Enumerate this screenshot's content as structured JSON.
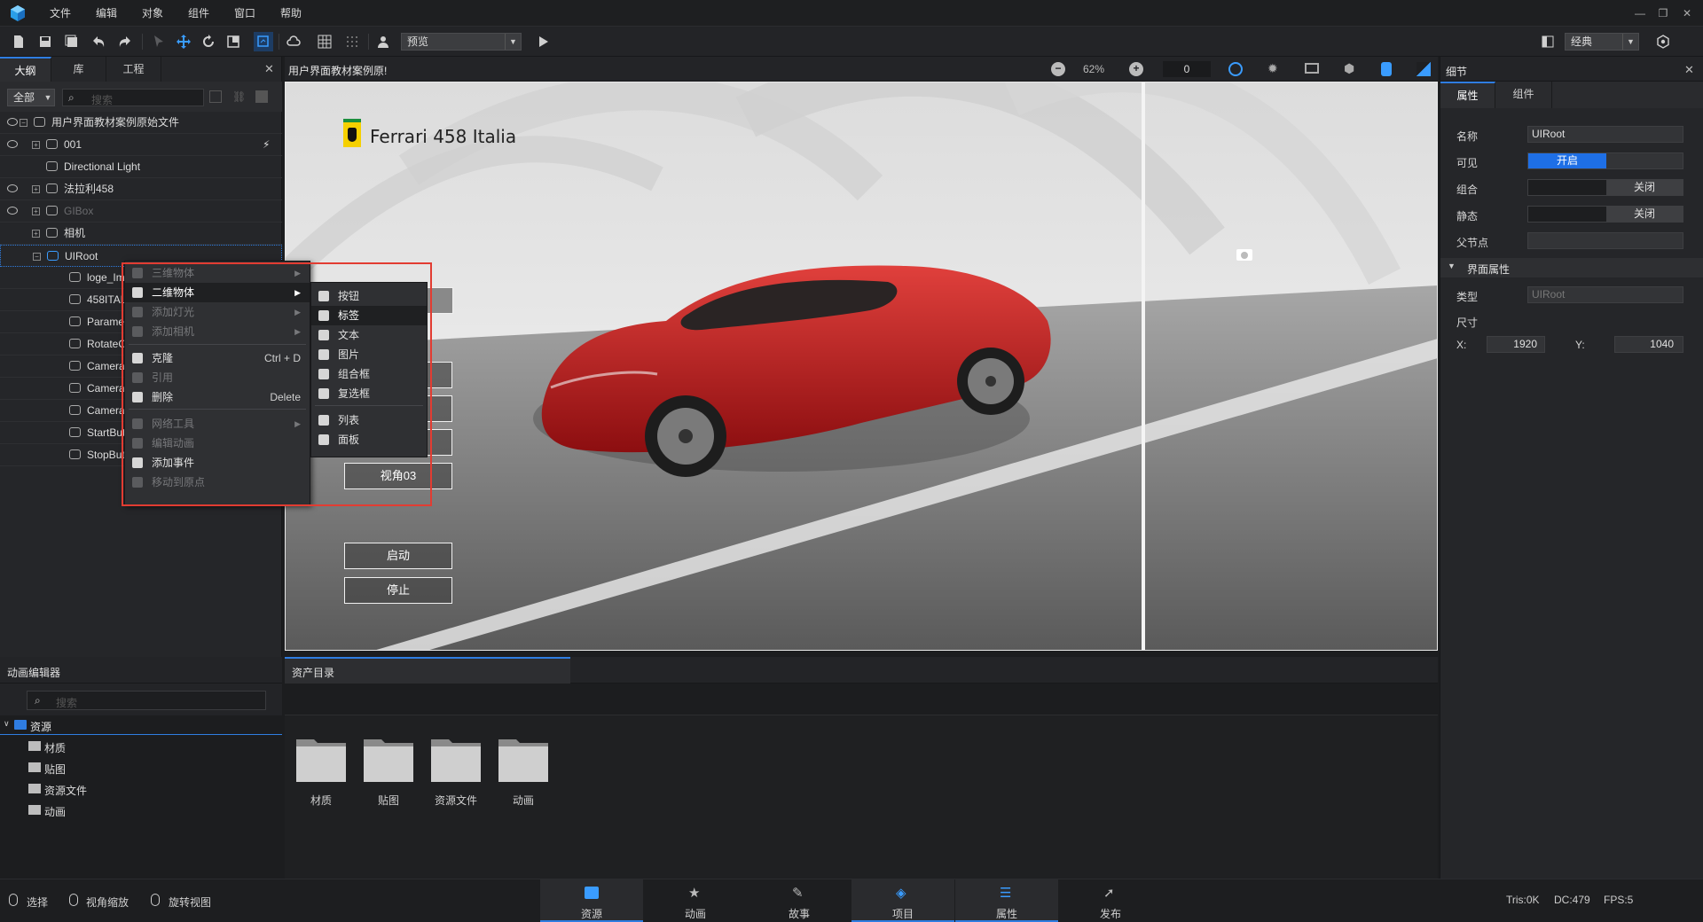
{
  "menubar": {
    "items": [
      "文件",
      "编辑",
      "对象",
      "组件",
      "窗口",
      "帮助"
    ]
  },
  "toolbar": {
    "preview_mode": "预览",
    "layout_mode": "经典"
  },
  "left_panel": {
    "tabs": [
      "大纲",
      "库",
      "工程"
    ],
    "filter": "全部",
    "search_placeholder": "搜索",
    "tree": [
      {
        "label": "用户界面教材案例原始文件",
        "level": 0
      },
      {
        "label": "001",
        "level": 1
      },
      {
        "label": "Directional Light",
        "level": 1
      },
      {
        "label": "法拉利458",
        "level": 1
      },
      {
        "label": "GIBox",
        "level": 1
      },
      {
        "label": "相机",
        "level": 1
      },
      {
        "label": "UIRoot",
        "level": 1
      },
      {
        "label": "loge_Ima",
        "level": 2
      },
      {
        "label": "458ITAL",
        "level": 2
      },
      {
        "label": "Paramet",
        "level": 2
      },
      {
        "label": "RotateCa",
        "level": 2
      },
      {
        "label": "Camera_",
        "level": 2
      },
      {
        "label": "Camera_",
        "level": 2
      },
      {
        "label": "Camera_",
        "level": 2
      },
      {
        "label": "StartButt",
        "level": 2
      },
      {
        "label": "StopButt",
        "level": 2
      }
    ]
  },
  "viewport": {
    "title": "用户界面教材案例原!",
    "zoom": "62%",
    "zoom_value": "0",
    "scene_title": "Ferrari 458 Italia",
    "buttons": {
      "view03": "视角03",
      "start": "启动",
      "stop": "停止"
    }
  },
  "context_menu": {
    "items": [
      {
        "label": "三维物体",
        "disabled": true,
        "submenu": true
      },
      {
        "label": "二维物体",
        "disabled": false,
        "submenu": true,
        "highlight": true
      },
      {
        "label": "添加灯光",
        "disabled": true,
        "submenu": true
      },
      {
        "label": "添加相机",
        "disabled": true,
        "submenu": true
      },
      {
        "label": "克隆",
        "disabled": false,
        "shortcut": "Ctrl + D"
      },
      {
        "label": "引用",
        "disabled": true
      },
      {
        "label": "删除",
        "disabled": false,
        "shortcut": "Delete"
      },
      {
        "label": "网络工具",
        "disabled": true,
        "submenu": true
      },
      {
        "label": "编辑动画",
        "disabled": true
      },
      {
        "label": "添加事件",
        "disabled": false
      },
      {
        "label": "移动到原点",
        "disabled": true
      }
    ],
    "submenu": [
      "按钮",
      "标签",
      "文本",
      "图片",
      "组合框",
      "复选框",
      "列表",
      "面板"
    ],
    "submenu_highlight": "标签"
  },
  "right_panel": {
    "title": "细节",
    "tabs": [
      "属性",
      "组件"
    ],
    "props": {
      "name_label": "名称",
      "name_value": "UIRoot",
      "visible_label": "可见",
      "visible_value": "开启",
      "group_label": "组合",
      "group_value": "关闭",
      "static_label": "静态",
      "static_value": "关闭",
      "parent_label": "父节点",
      "section": "界面属性",
      "type_label": "类型",
      "type_value": "UIRoot",
      "size_label": "尺寸",
      "x_label": "X:",
      "x_value": "1920",
      "y_label": "Y:",
      "y_value": "1040"
    }
  },
  "anim_panel": {
    "title": "动画编辑器",
    "search_placeholder": "搜索",
    "tree": [
      {
        "label": "资源",
        "root": true
      },
      {
        "label": "材质"
      },
      {
        "label": "贴图"
      },
      {
        "label": "资源文件"
      },
      {
        "label": "动画"
      }
    ]
  },
  "asset_panel": {
    "title": "资产目录",
    "folders": [
      "材质",
      "贴图",
      "资源文件",
      "动画"
    ]
  },
  "statusbar": {
    "tools": [
      "选择",
      "视角缩放",
      "旋转视图"
    ],
    "tabs": [
      "资源",
      "动画",
      "故事",
      "项目",
      "属性",
      "发布"
    ],
    "stats": {
      "tris": "Tris:0K",
      "dc": "DC:479",
      "fps": "FPS:5"
    }
  },
  "colors": {
    "accent": "#2f7de1",
    "highlight_box": "#e23c32",
    "toggle_on": "#1e6fe6"
  }
}
